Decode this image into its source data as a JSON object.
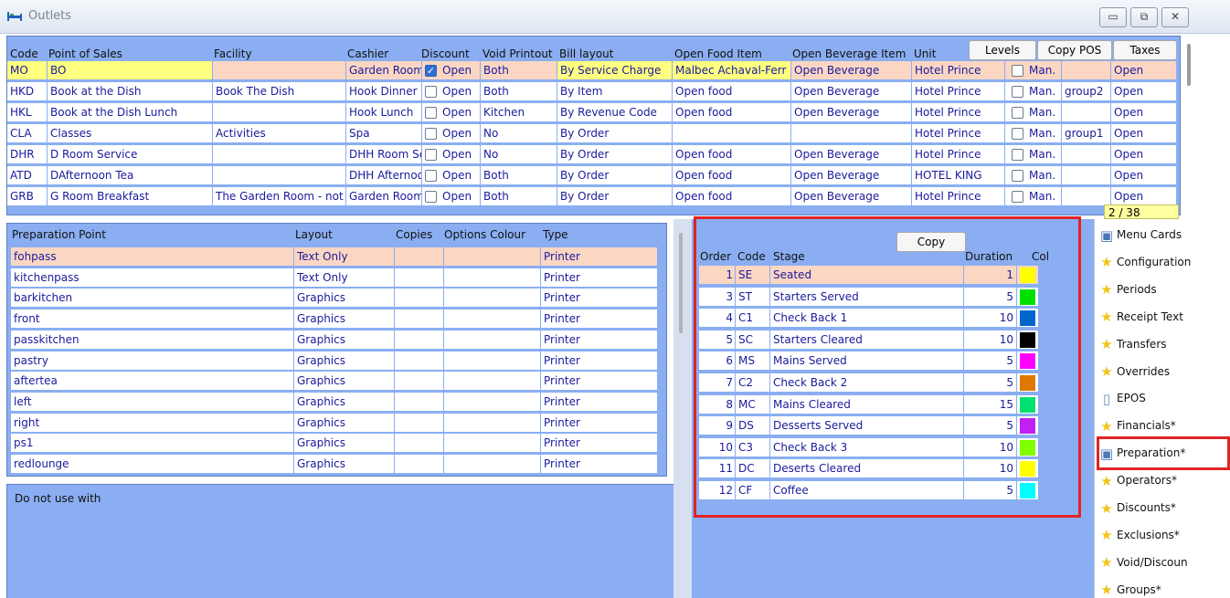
{
  "window": {
    "title": "Outlets",
    "buttons": [
      "▭",
      "⧉",
      "✕"
    ]
  },
  "outlets": {
    "headers": [
      "Code",
      "Point of Sales",
      "Facility",
      "Cashier",
      "Discount",
      "Void Printout",
      "Bill layout",
      "Open Food Item",
      "Open Beverage Item",
      "Unit"
    ],
    "buttons": {
      "levels": "Levels",
      "copy_pos": "Copy POS",
      "taxes": "Taxes"
    },
    "rows": [
      {
        "code": "MO",
        "pos": "BO",
        "facility": "",
        "cashier": "Garden Room",
        "discount": true,
        "discount_label": "Open",
        "void": "Both",
        "bill": "By Service Charge",
        "food": "Malbec Achaval-Ferr",
        "bev": "Open Beverage",
        "unit": "Hotel Prince",
        "man": "Man.",
        "group": "",
        "taxes": "Open"
      },
      {
        "code": "HKD",
        "pos": "Book at the Dish",
        "facility": "Book The Dish",
        "cashier": "Hook Dinner",
        "discount": false,
        "discount_label": "Open",
        "void": "Both",
        "bill": "By Item",
        "food": "Open food",
        "bev": "Open Beverage",
        "unit": "Hotel Prince",
        "man": "Man.",
        "group": "group2",
        "taxes": "Open"
      },
      {
        "code": "HKL",
        "pos": "Book at the Dish Lunch",
        "facility": "",
        "cashier": "Hook Lunch",
        "discount": false,
        "discount_label": "Open",
        "void": "Kitchen",
        "bill": "By Revenue Code",
        "food": "Open food",
        "bev": "Open Beverage",
        "unit": "Hotel Prince",
        "man": "Man.",
        "group": "",
        "taxes": "Open"
      },
      {
        "code": "CLA",
        "pos": "Classes",
        "facility": "Activities",
        "cashier": "Spa",
        "discount": false,
        "discount_label": "Open",
        "void": "No",
        "bill": "By Order",
        "food": "",
        "bev": "",
        "unit": "Hotel Prince",
        "man": "Man.",
        "group": "group1",
        "taxes": "Open"
      },
      {
        "code": "DHR",
        "pos": "D Room Service",
        "facility": "",
        "cashier": "DHH Room Se",
        "discount": false,
        "discount_label": "Open",
        "void": "No",
        "bill": "By Order",
        "food": "Open food",
        "bev": "Open Beverage",
        "unit": "Hotel Prince",
        "man": "Man.",
        "group": "",
        "taxes": "Open"
      },
      {
        "code": "ATD",
        "pos": "DAfternoon Tea",
        "facility": "",
        "cashier": "DHH Afternoo",
        "discount": false,
        "discount_label": "Open",
        "void": "Both",
        "bill": "By Order",
        "food": "Open food",
        "bev": "Open Beverage",
        "unit": "HOTEL KING",
        "man": "Man.",
        "group": "",
        "taxes": "Open"
      },
      {
        "code": "GRB",
        "pos": "G Room Breakfast",
        "facility": "The Garden Room - not",
        "cashier": "Garden Room",
        "discount": false,
        "discount_label": "Open",
        "void": "Both",
        "bill": "By Order",
        "food": "Open food",
        "bev": "Open Beverage",
        "unit": "Hotel Prince",
        "man": "Man.",
        "group": "",
        "taxes": "Open"
      }
    ],
    "counter": "2 / 38"
  },
  "preparation": {
    "headers": [
      "Preparation Point",
      "Layout",
      "Copies",
      "Options Colour",
      "Type"
    ],
    "rows": [
      {
        "name": "fohpass",
        "layout": "Text Only",
        "type": "Printer"
      },
      {
        "name": "kitchenpass",
        "layout": "Text Only",
        "type": "Printer"
      },
      {
        "name": "barkitchen",
        "layout": "Graphics",
        "type": "Printer"
      },
      {
        "name": "front",
        "layout": "Graphics",
        "type": "Printer"
      },
      {
        "name": "passkitchen",
        "layout": "Graphics",
        "type": "Printer"
      },
      {
        "name": "pastry",
        "layout": "Graphics",
        "type": "Printer"
      },
      {
        "name": "aftertea",
        "layout": "Graphics",
        "type": "Printer"
      },
      {
        "name": "left",
        "layout": "Graphics",
        "type": "Printer"
      },
      {
        "name": "right",
        "layout": "Graphics",
        "type": "Printer"
      },
      {
        "name": "ps1",
        "layout": "Graphics",
        "type": "Printer"
      },
      {
        "name": "redlounge",
        "layout": "Graphics",
        "type": "Printer"
      }
    ],
    "notes": "Do not use with"
  },
  "stages": {
    "copy_label": "Copy",
    "headers": [
      "Order",
      "Code",
      "Stage",
      "Duration",
      "Col"
    ],
    "rows": [
      {
        "order": "1",
        "code": "SE",
        "stage": "Seated",
        "duration": "1",
        "color": "#ffff00"
      },
      {
        "order": "3",
        "code": "ST",
        "stage": "Starters Served",
        "duration": "5",
        "color": "#00e000"
      },
      {
        "order": "4",
        "code": "C1",
        "stage": "Check Back 1",
        "duration": "10",
        "color": "#0066cc"
      },
      {
        "order": "5",
        "code": "SC",
        "stage": "Starters Cleared",
        "duration": "10",
        "color": "#000000"
      },
      {
        "order": "6",
        "code": "MS",
        "stage": "Mains Served",
        "duration": "5",
        "color": "#ff00ff"
      },
      {
        "order": "7",
        "code": "C2",
        "stage": "Check Back 2",
        "duration": "5",
        "color": "#e07800"
      },
      {
        "order": "8",
        "code": "MC",
        "stage": "Mains Cleared",
        "duration": "15",
        "color": "#00e070"
      },
      {
        "order": "9",
        "code": "DS",
        "stage": "Desserts Served",
        "duration": "5",
        "color": "#c020f0"
      },
      {
        "order": "10",
        "code": "C3",
        "stage": "Check Back 3",
        "duration": "10",
        "color": "#80ff00"
      },
      {
        "order": "11",
        "code": "DC",
        "stage": "Deserts Cleared",
        "duration": "10",
        "color": "#ffff00"
      },
      {
        "order": "12",
        "code": "CF",
        "stage": "Coffee",
        "duration": "5",
        "color": "#00ffff"
      }
    ]
  },
  "side_menu": [
    {
      "label": "Menu Cards",
      "icon": "menu-cards-icon"
    },
    {
      "label": "Configuration",
      "icon": "star-icon"
    },
    {
      "label": "Periods",
      "icon": "star-icon"
    },
    {
      "label": "Receipt Text",
      "icon": "star-icon"
    },
    {
      "label": "Transfers",
      "icon": "star-icon"
    },
    {
      "label": "Overrides",
      "icon": "star-icon"
    },
    {
      "label": "EPOS",
      "icon": "document-icon"
    },
    {
      "label": "Financials*",
      "icon": "star-icon"
    },
    {
      "label": "Preparation*",
      "icon": "preparation-icon"
    },
    {
      "label": "Operators*",
      "icon": "star-icon"
    },
    {
      "label": "Discounts*",
      "icon": "star-icon"
    },
    {
      "label": "Exclusions*",
      "icon": "star-icon"
    },
    {
      "label": "Void/Discoun",
      "icon": "star-icon"
    },
    {
      "label": "Groups*",
      "icon": "star-icon"
    }
  ]
}
